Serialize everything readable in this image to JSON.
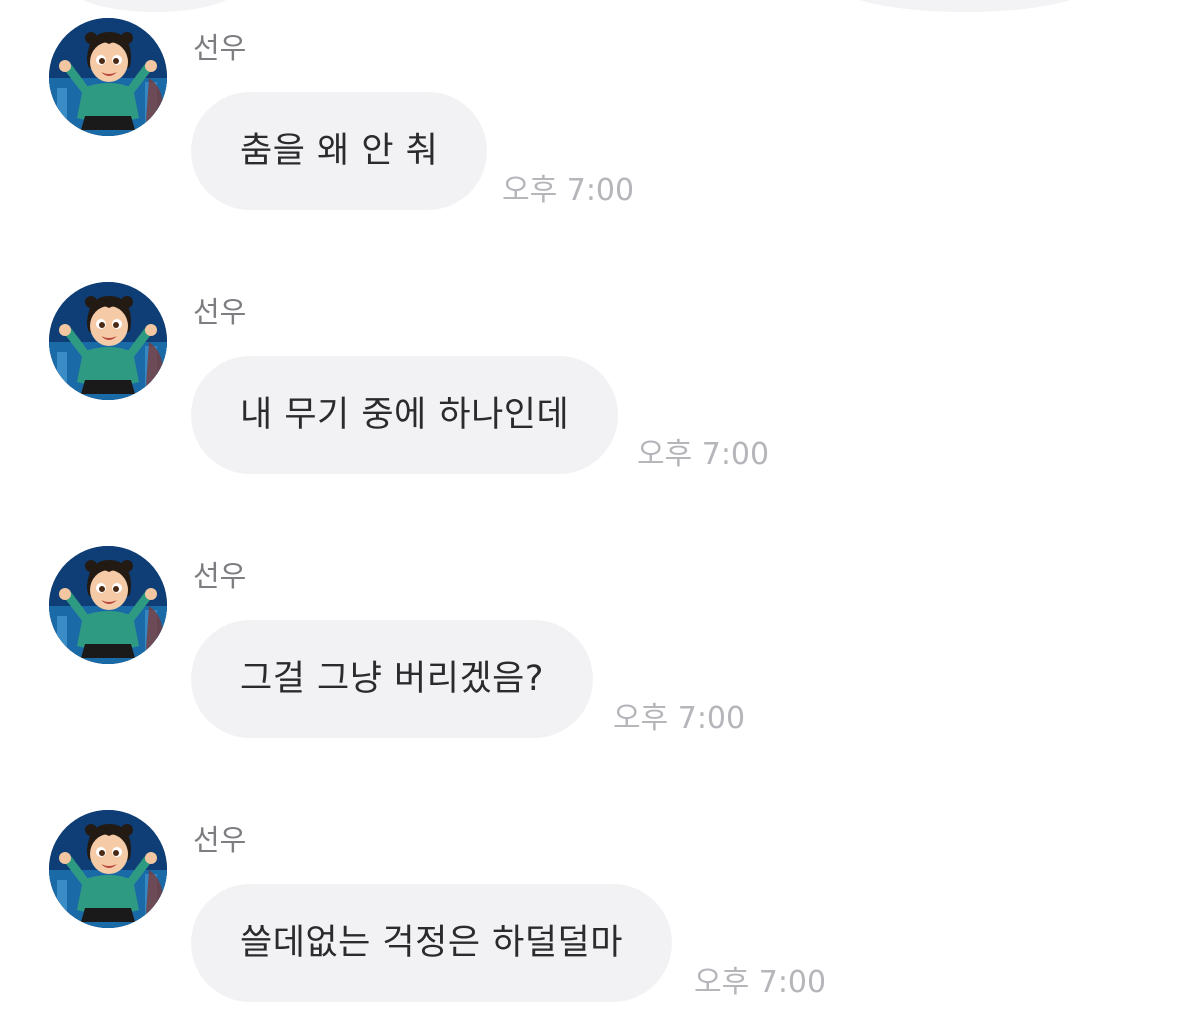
{
  "messages": [
    {
      "sender": "선우",
      "text": "춤을 왜 안 춰",
      "time": "오후 7:00"
    },
    {
      "sender": "선우",
      "text": "내 무기 중에 하나인데",
      "time": "오후 7:00"
    },
    {
      "sender": "선우",
      "text": "그걸 그냥 버리겠음?",
      "time": "오후 7:00"
    },
    {
      "sender": "선우",
      "text": "쓸데없는 걱정은 하덜덜마",
      "time": "오후 7:00"
    }
  ]
}
